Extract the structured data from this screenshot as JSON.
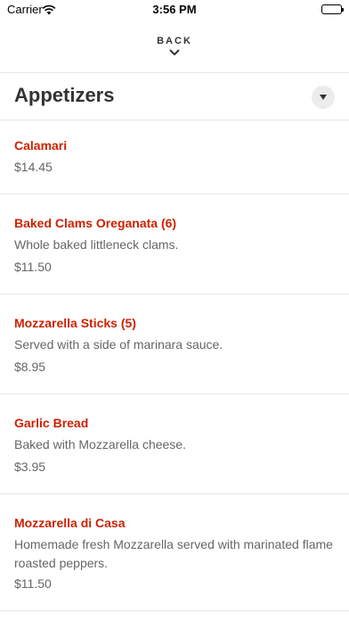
{
  "status_bar": {
    "carrier": "Carrier",
    "time": "3:56 PM"
  },
  "nav": {
    "back_label": "BACK"
  },
  "section": {
    "title": "Appetizers"
  },
  "items": [
    {
      "name": "Calamari",
      "description": "",
      "price": "$14.45"
    },
    {
      "name": "Baked Clams Oreganata (6)",
      "description": "Whole baked littleneck clams.",
      "price": "$11.50"
    },
    {
      "name": "Mozzarella Sticks (5)",
      "description": "Served with a side of marinara sauce.",
      "price": "$8.95"
    },
    {
      "name": "Garlic Bread",
      "description": "Baked with Mozzarella cheese.",
      "price": "$3.95"
    },
    {
      "name": "Mozzarella di Casa",
      "description": "Homemade fresh Mozzarella served with marinated flame roasted peppers.",
      "price": "$11.50"
    }
  ],
  "colors": {
    "item_name": "#cc2200",
    "secondary_text": "#666666",
    "divider": "#e6e6e6"
  },
  "icons": [
    "wifi-icon",
    "battery-icon",
    "chevron-down-icon",
    "dropdown-caret-icon"
  ]
}
